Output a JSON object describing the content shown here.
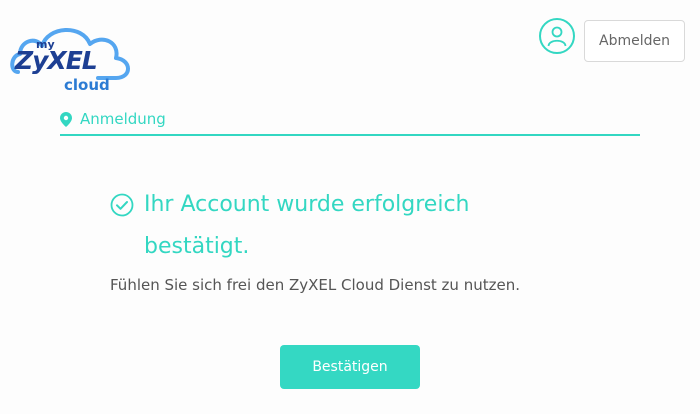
{
  "logo": {
    "my": "my",
    "brand": "ZyXEL",
    "cloud": "cloud"
  },
  "header": {
    "logout_label": "Abmelden"
  },
  "tab": {
    "label": "Anmeldung"
  },
  "success": {
    "title_line1": "Ihr Account wurde erfolgreich",
    "title_line2": "bestätigt."
  },
  "message": "Fühlen Sie sich frei den ZyXEL Cloud Dienst zu nutzen.",
  "confirm_label": "Bestätigen",
  "icons": {
    "profile": "user-icon",
    "location": "map-pin-icon",
    "success": "check-circle-icon"
  },
  "colors": {
    "accent": "#33d7c2",
    "brand_dark": "#1d3f93",
    "brand_light": "#2c7bd3",
    "text": "#555555"
  }
}
